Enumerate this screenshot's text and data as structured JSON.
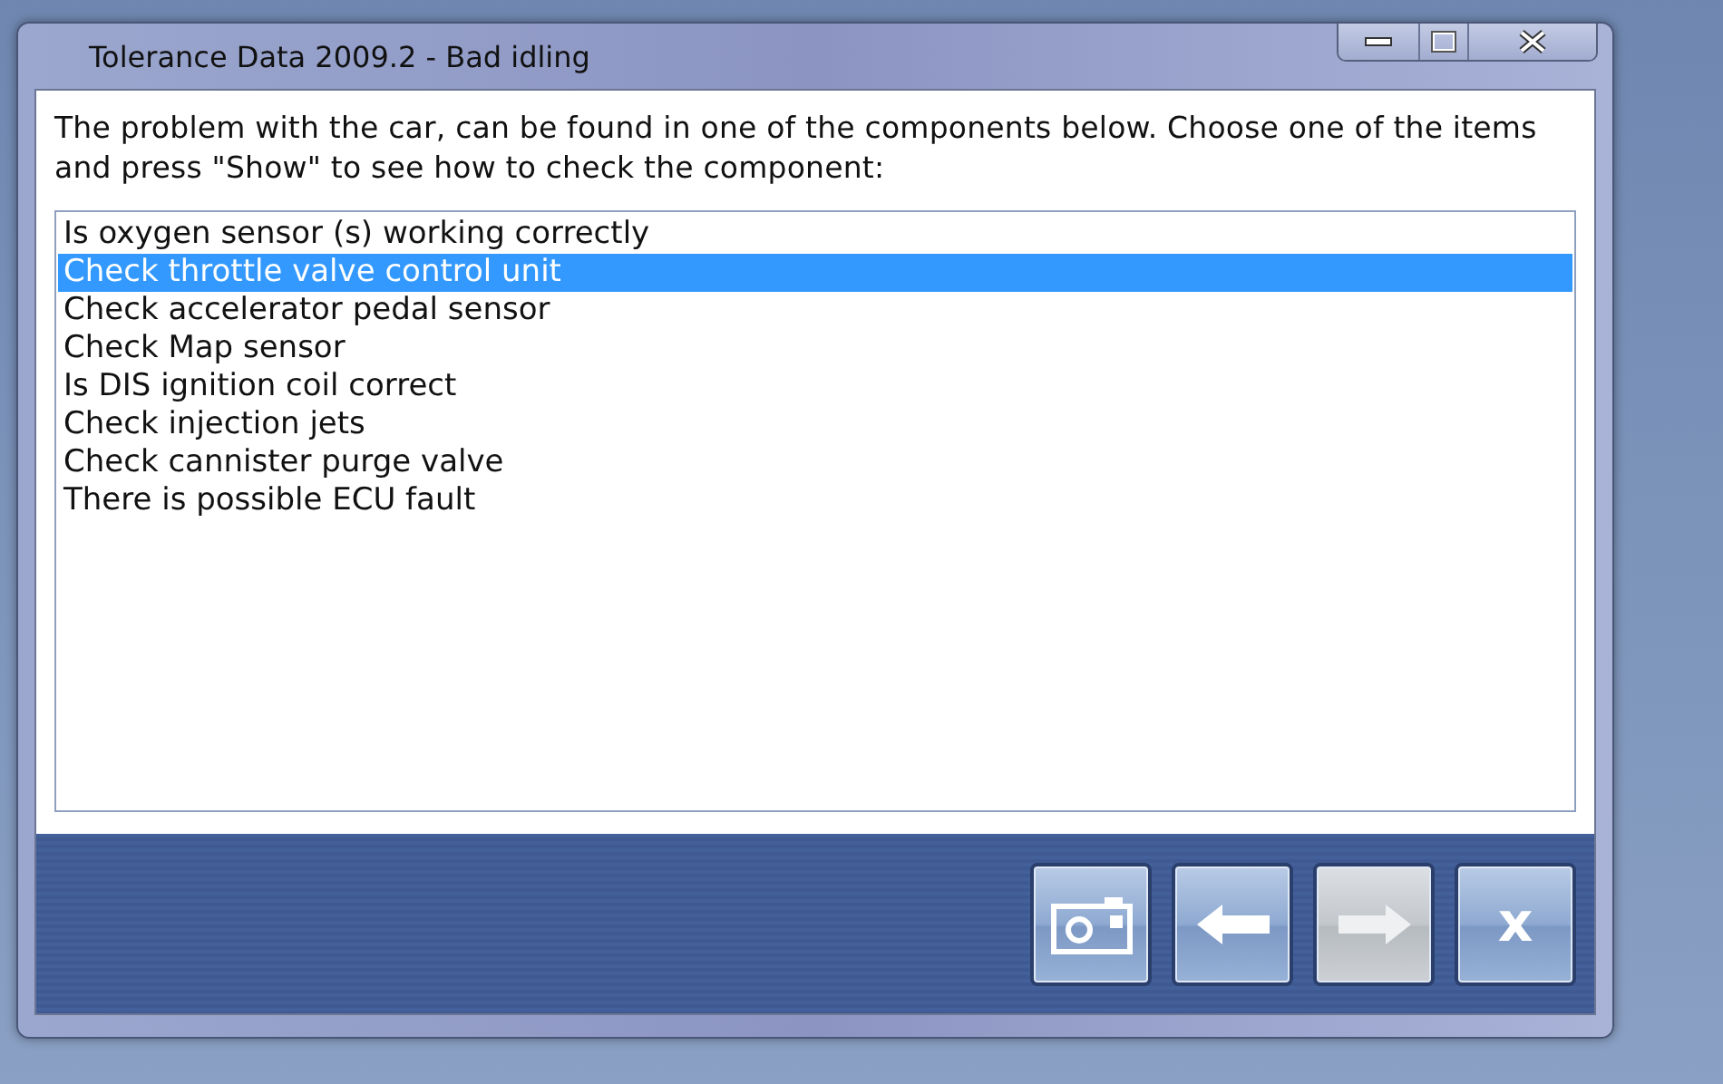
{
  "window": {
    "title": "Tolerance Data 2009.2 - Bad idling"
  },
  "instruction": "The problem with the car, can be found in one of the components below. Choose one of the items and press \"Show\" to see how to check the component:",
  "items": [
    {
      "label": "Is oxygen sensor (s) working correctly",
      "selected": false
    },
    {
      "label": "Check throttle valve control unit",
      "selected": true
    },
    {
      "label": "Check accelerator pedal sensor",
      "selected": false
    },
    {
      "label": "Check Map sensor",
      "selected": false
    },
    {
      "label": "Is DIS ignition coil correct",
      "selected": false
    },
    {
      "label": "Check injection jets",
      "selected": false
    },
    {
      "label": "Check cannister purge valve",
      "selected": false
    },
    {
      "label": "There is possible ECU fault",
      "selected": false
    }
  ],
  "buttons": [
    {
      "kind": "camera",
      "disabled": false
    },
    {
      "kind": "back",
      "disabled": false
    },
    {
      "kind": "forward",
      "disabled": true
    },
    {
      "kind": "close",
      "text": "x",
      "disabled": false
    }
  ]
}
